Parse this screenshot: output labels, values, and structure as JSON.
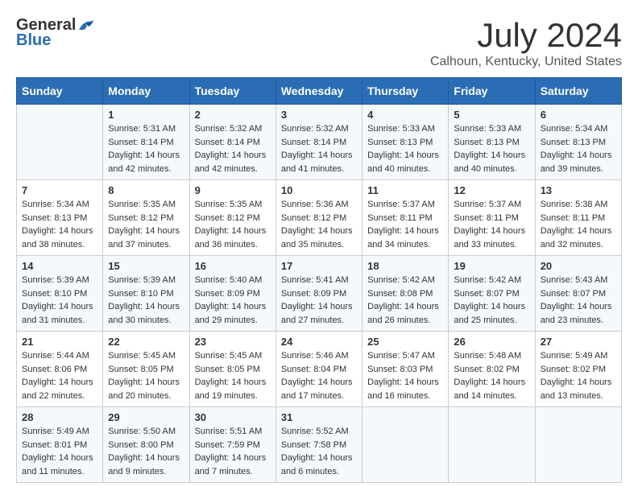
{
  "header": {
    "logo_general": "General",
    "logo_blue": "Blue",
    "month_title": "July 2024",
    "location": "Calhoun, Kentucky, United States"
  },
  "calendar": {
    "days_of_week": [
      "Sunday",
      "Monday",
      "Tuesday",
      "Wednesday",
      "Thursday",
      "Friday",
      "Saturday"
    ],
    "weeks": [
      [
        {
          "day": "",
          "info": ""
        },
        {
          "day": "1",
          "info": "Sunrise: 5:31 AM\nSunset: 8:14 PM\nDaylight: 14 hours\nand 42 minutes."
        },
        {
          "day": "2",
          "info": "Sunrise: 5:32 AM\nSunset: 8:14 PM\nDaylight: 14 hours\nand 42 minutes."
        },
        {
          "day": "3",
          "info": "Sunrise: 5:32 AM\nSunset: 8:14 PM\nDaylight: 14 hours\nand 41 minutes."
        },
        {
          "day": "4",
          "info": "Sunrise: 5:33 AM\nSunset: 8:13 PM\nDaylight: 14 hours\nand 40 minutes."
        },
        {
          "day": "5",
          "info": "Sunrise: 5:33 AM\nSunset: 8:13 PM\nDaylight: 14 hours\nand 40 minutes."
        },
        {
          "day": "6",
          "info": "Sunrise: 5:34 AM\nSunset: 8:13 PM\nDaylight: 14 hours\nand 39 minutes."
        }
      ],
      [
        {
          "day": "7",
          "info": "Sunrise: 5:34 AM\nSunset: 8:13 PM\nDaylight: 14 hours\nand 38 minutes."
        },
        {
          "day": "8",
          "info": "Sunrise: 5:35 AM\nSunset: 8:12 PM\nDaylight: 14 hours\nand 37 minutes."
        },
        {
          "day": "9",
          "info": "Sunrise: 5:35 AM\nSunset: 8:12 PM\nDaylight: 14 hours\nand 36 minutes."
        },
        {
          "day": "10",
          "info": "Sunrise: 5:36 AM\nSunset: 8:12 PM\nDaylight: 14 hours\nand 35 minutes."
        },
        {
          "day": "11",
          "info": "Sunrise: 5:37 AM\nSunset: 8:11 PM\nDaylight: 14 hours\nand 34 minutes."
        },
        {
          "day": "12",
          "info": "Sunrise: 5:37 AM\nSunset: 8:11 PM\nDaylight: 14 hours\nand 33 minutes."
        },
        {
          "day": "13",
          "info": "Sunrise: 5:38 AM\nSunset: 8:11 PM\nDaylight: 14 hours\nand 32 minutes."
        }
      ],
      [
        {
          "day": "14",
          "info": "Sunrise: 5:39 AM\nSunset: 8:10 PM\nDaylight: 14 hours\nand 31 minutes."
        },
        {
          "day": "15",
          "info": "Sunrise: 5:39 AM\nSunset: 8:10 PM\nDaylight: 14 hours\nand 30 minutes."
        },
        {
          "day": "16",
          "info": "Sunrise: 5:40 AM\nSunset: 8:09 PM\nDaylight: 14 hours\nand 29 minutes."
        },
        {
          "day": "17",
          "info": "Sunrise: 5:41 AM\nSunset: 8:09 PM\nDaylight: 14 hours\nand 27 minutes."
        },
        {
          "day": "18",
          "info": "Sunrise: 5:42 AM\nSunset: 8:08 PM\nDaylight: 14 hours\nand 26 minutes."
        },
        {
          "day": "19",
          "info": "Sunrise: 5:42 AM\nSunset: 8:07 PM\nDaylight: 14 hours\nand 25 minutes."
        },
        {
          "day": "20",
          "info": "Sunrise: 5:43 AM\nSunset: 8:07 PM\nDaylight: 14 hours\nand 23 minutes."
        }
      ],
      [
        {
          "day": "21",
          "info": "Sunrise: 5:44 AM\nSunset: 8:06 PM\nDaylight: 14 hours\nand 22 minutes."
        },
        {
          "day": "22",
          "info": "Sunrise: 5:45 AM\nSunset: 8:05 PM\nDaylight: 14 hours\nand 20 minutes."
        },
        {
          "day": "23",
          "info": "Sunrise: 5:45 AM\nSunset: 8:05 PM\nDaylight: 14 hours\nand 19 minutes."
        },
        {
          "day": "24",
          "info": "Sunrise: 5:46 AM\nSunset: 8:04 PM\nDaylight: 14 hours\nand 17 minutes."
        },
        {
          "day": "25",
          "info": "Sunrise: 5:47 AM\nSunset: 8:03 PM\nDaylight: 14 hours\nand 16 minutes."
        },
        {
          "day": "26",
          "info": "Sunrise: 5:48 AM\nSunset: 8:02 PM\nDaylight: 14 hours\nand 14 minutes."
        },
        {
          "day": "27",
          "info": "Sunrise: 5:49 AM\nSunset: 8:02 PM\nDaylight: 14 hours\nand 13 minutes."
        }
      ],
      [
        {
          "day": "28",
          "info": "Sunrise: 5:49 AM\nSunset: 8:01 PM\nDaylight: 14 hours\nand 11 minutes."
        },
        {
          "day": "29",
          "info": "Sunrise: 5:50 AM\nSunset: 8:00 PM\nDaylight: 14 hours\nand 9 minutes."
        },
        {
          "day": "30",
          "info": "Sunrise: 5:51 AM\nSunset: 7:59 PM\nDaylight: 14 hours\nand 7 minutes."
        },
        {
          "day": "31",
          "info": "Sunrise: 5:52 AM\nSunset: 7:58 PM\nDaylight: 14 hours\nand 6 minutes."
        },
        {
          "day": "",
          "info": ""
        },
        {
          "day": "",
          "info": ""
        },
        {
          "day": "",
          "info": ""
        }
      ]
    ]
  }
}
